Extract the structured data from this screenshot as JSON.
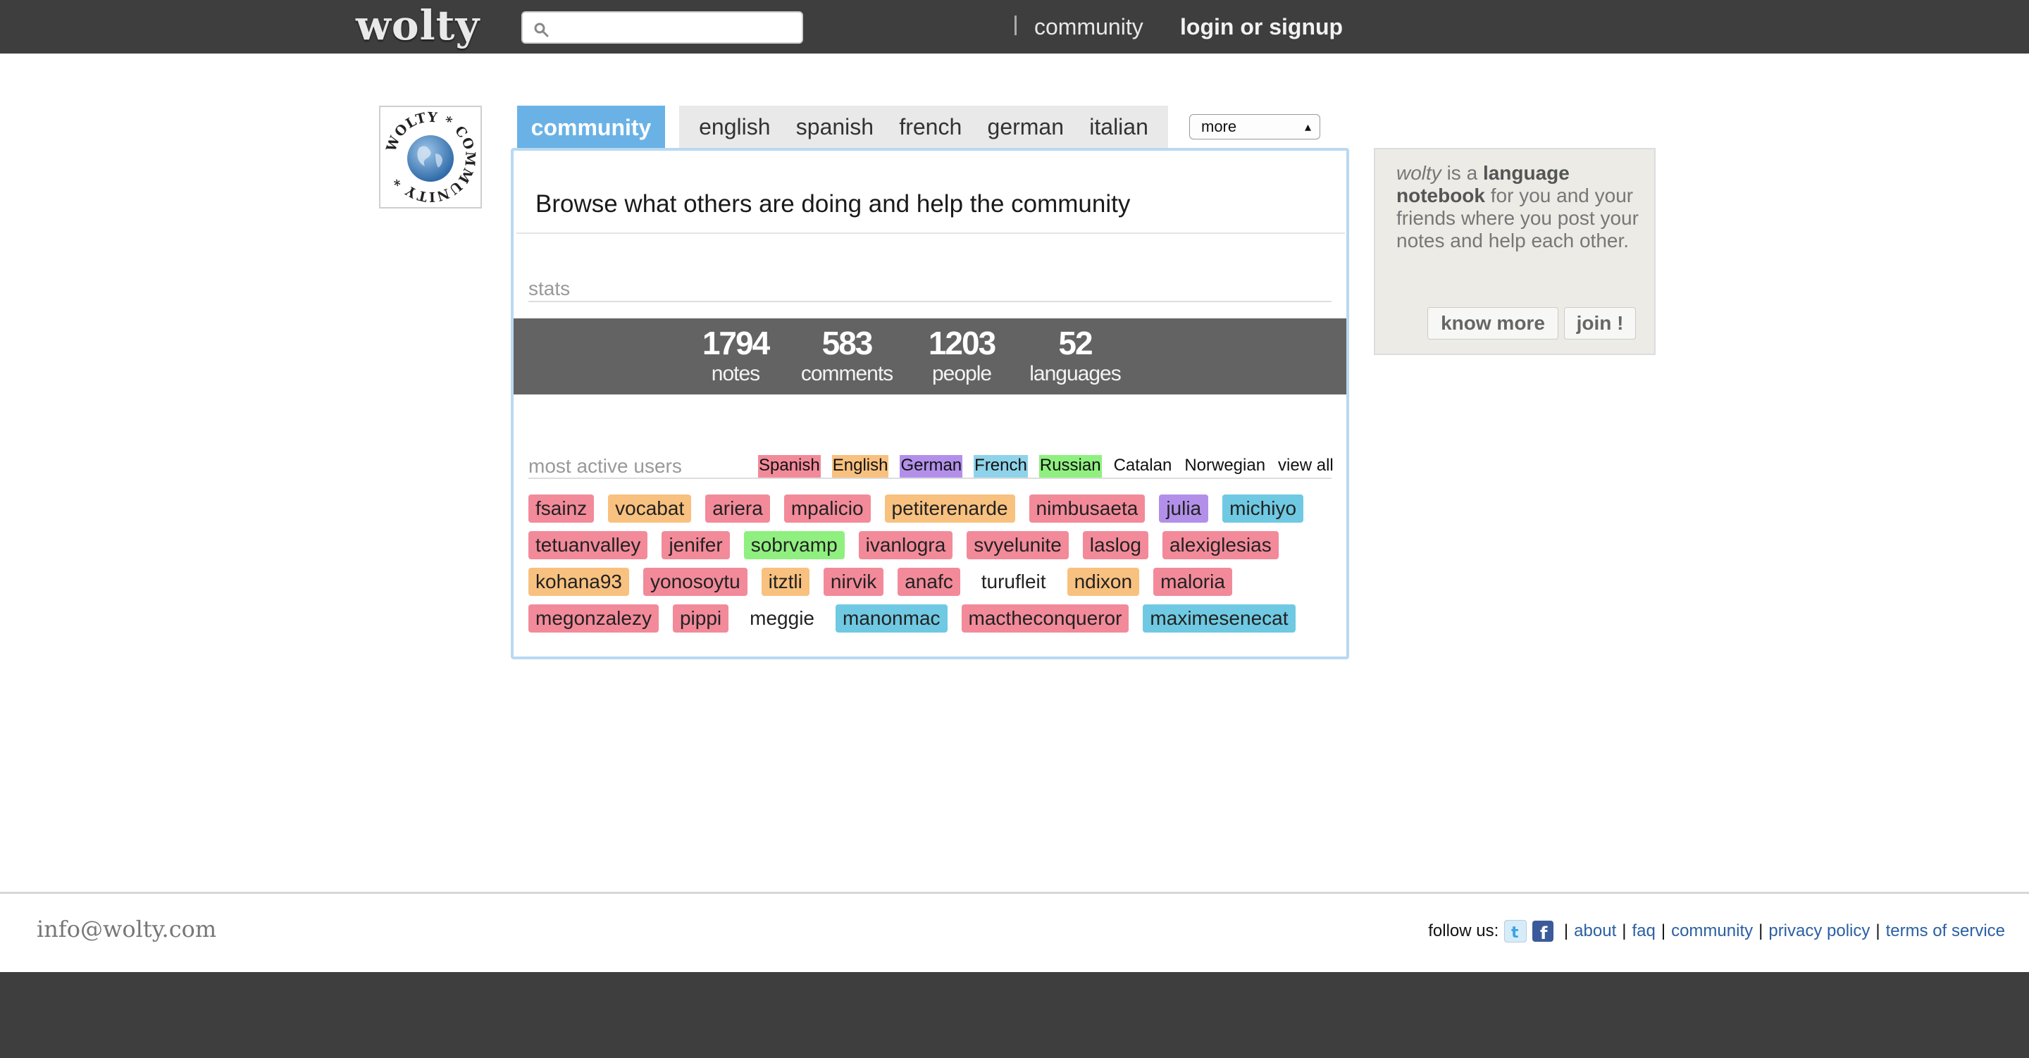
{
  "header": {
    "logo": "wolty",
    "search": {
      "value": "",
      "placeholder": ""
    },
    "nav": {
      "community": "community",
      "login": "login or signup"
    }
  },
  "tabs": {
    "active": "community",
    "languages": [
      "english",
      "spanish",
      "french",
      "german",
      "italian"
    ],
    "more": "more"
  },
  "badge": {
    "text": "WOLTY * COMMUNITY *"
  },
  "main": {
    "headline": "Browse what others are doing and help the community",
    "stats_label": "stats",
    "stats": [
      {
        "value": "1794",
        "label": "notes"
      },
      {
        "value": "583",
        "label": "comments"
      },
      {
        "value": "1203",
        "label": "people"
      },
      {
        "value": "52",
        "label": "languages"
      }
    ],
    "active_label": "most active users",
    "language_filter": [
      {
        "name": "Spanish",
        "color": "#f28a9a"
      },
      {
        "name": "English",
        "color": "#f8c17f"
      },
      {
        "name": "German",
        "color": "#b290ea"
      },
      {
        "name": "French",
        "color": "#8fd3ea"
      },
      {
        "name": "Russian",
        "color": "#8ff07f"
      },
      {
        "name": "Catalan",
        "color": ""
      },
      {
        "name": "Norwegian",
        "color": ""
      },
      {
        "name": "view all",
        "color": ""
      }
    ],
    "users": [
      [
        {
          "name": "fsainz",
          "color": "#f28a9a"
        },
        {
          "name": "vocabat",
          "color": "#f8c17f"
        },
        {
          "name": "ariera",
          "color": "#f28a9a"
        },
        {
          "name": "mpalicio",
          "color": "#f28a9a"
        },
        {
          "name": "petiterenarde",
          "color": "#f8c17f"
        },
        {
          "name": "nimbusaeta",
          "color": "#f28a9a"
        },
        {
          "name": "julia",
          "color": "#b290ea"
        },
        {
          "name": "michiyo",
          "color": "#6fc9e2"
        }
      ],
      [
        {
          "name": "tetuanvalley",
          "color": "#f28a9a"
        },
        {
          "name": "jenifer",
          "color": "#f28a9a"
        },
        {
          "name": "sobrvamp",
          "color": "#8ff07f"
        },
        {
          "name": "ivanlogra",
          "color": "#f28a9a"
        },
        {
          "name": "svyelunite",
          "color": "#f28a9a"
        },
        {
          "name": "laslog",
          "color": "#f28a9a"
        },
        {
          "name": "alexiglesias",
          "color": "#f28a9a"
        }
      ],
      [
        {
          "name": "kohana93",
          "color": "#f8c17f"
        },
        {
          "name": "yonosoytu",
          "color": "#f28a9a"
        },
        {
          "name": "itztli",
          "color": "#f8c17f"
        },
        {
          "name": "nirvik",
          "color": "#f28a9a"
        },
        {
          "name": "anafc",
          "color": "#f28a9a"
        },
        {
          "name": "turufleit",
          "color": ""
        },
        {
          "name": "ndixon",
          "color": "#f8c17f"
        },
        {
          "name": "maloria",
          "color": "#f28a9a"
        }
      ],
      [
        {
          "name": "megonzalezy",
          "color": "#f28a9a"
        },
        {
          "name": "pippi",
          "color": "#f28a9a"
        },
        {
          "name": "meggie",
          "color": ""
        },
        {
          "name": "manonmac",
          "color": "#6fc9e2"
        },
        {
          "name": "mactheconqueror",
          "color": "#f28a9a"
        },
        {
          "name": "maximesenecat",
          "color": "#6fc9e2"
        }
      ]
    ]
  },
  "sidebar": {
    "brand": "wolty",
    "text1": " is a ",
    "bold1": "language notebook",
    "text2": " for you and your friends where you post your notes and help each other.",
    "know_more": "know more",
    "join": "join !"
  },
  "footer": {
    "email": "info@wolty.com",
    "follow": "follow us:",
    "social": [
      "twitter-icon",
      "facebook-icon"
    ],
    "links": [
      "about",
      "faq",
      "community",
      "privacy policy",
      "terms of service"
    ]
  },
  "colors": {
    "accent": "#6ab2e6",
    "topbar": "#3e3e3e",
    "stats_band": "#636363",
    "panel_border": "#b9d9f2"
  }
}
